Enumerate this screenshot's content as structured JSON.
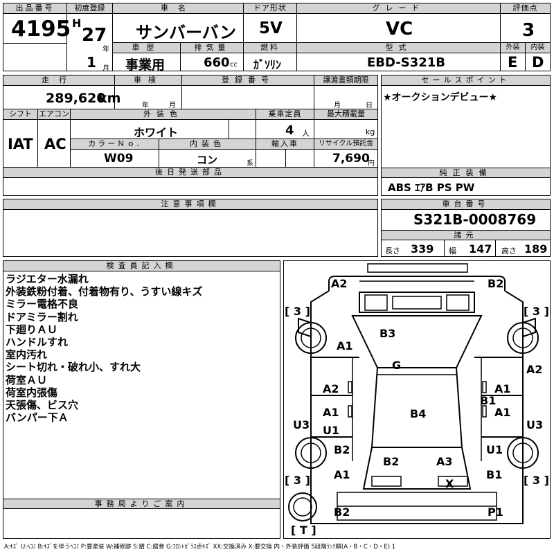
{
  "headers": {
    "lot_no": "出品番号",
    "first_reg": "初度登録",
    "car_name": "車名",
    "door": "ドア形状",
    "grade": "グレード",
    "score": "評価点",
    "history": "車歴",
    "displacement": "排気量",
    "fuel": "燃料",
    "model": "型式",
    "exterior": "外装",
    "interior": "内装",
    "mileage": "走行",
    "inspection": "車検",
    "reg_no": "登録番号",
    "transfer_deadline": "譲渡書類期限",
    "sales_point": "セールスポイント",
    "shift": "シフト",
    "aircon": "エアコン",
    "ext_color": "外装色",
    "capacity": "乗車定員",
    "max_load": "最大積載量",
    "color_no": "カラーＮｏ.",
    "int_color": "内装色",
    "import": "輸入車",
    "recycle": "リサイクル預託金",
    "later_parts": "後日発送部品",
    "options": "純正装備",
    "notes": "注意事項欄",
    "chassis": "車台番号",
    "specs": "諸元",
    "inspector": "検査員記入欄",
    "office": "事務局よりご案内"
  },
  "vehicle": {
    "lot_no": "4195",
    "era": "H",
    "year": "27",
    "year_unit": "年",
    "month": "1",
    "month_unit": "月",
    "name": "サンバーバン",
    "door": "5V",
    "grade": "VC",
    "score": "3",
    "history": "事業用",
    "displacement": "660",
    "displacement_unit": "cc",
    "fuel": "ｶﾞｿﾘﾝ",
    "model": "EBD-S321B",
    "exterior_grade": "E",
    "interior_grade": "D",
    "mileage": "289,620",
    "mileage_unit": "km",
    "insp_year": "年",
    "insp_month": "月",
    "deadline_month": "月",
    "deadline_day": "日",
    "shift": "IAT",
    "aircon": "AC",
    "color": "ホワイト",
    "capacity": "4",
    "capacity_unit": "人",
    "load_unit": "kg",
    "color_no": "W09",
    "int_color": "コン",
    "int_color_unit": "系",
    "recycle": "7,690",
    "recycle_unit": "円",
    "sales_point": "★オークションデビュー★",
    "options": "ABS ｴｱB PS PW",
    "chassis": "S321B-0008769",
    "length_label": "長さ",
    "length": "339",
    "width_label": "幅",
    "width": "147",
    "height_label": "高さ",
    "height": "189"
  },
  "remarks": [
    "ラジエター水漏れ",
    "外装鉄粉付着、付着物有り、うすい線キズ",
    "ミラー電格不良",
    "ドアミラー割れ",
    "下廻りＡＵ",
    "ハンドルすれ",
    "室内汚れ",
    "シート切れ・破れ小、すれ大",
    "荷室ＡＵ",
    "荷室内張傷",
    "天張傷、ビス穴",
    "バンパー下Ａ"
  ],
  "diagram": {
    "marks": {
      "front_left": "A2",
      "front_right": "B2",
      "hood_left": "A1",
      "windshield": "B3",
      "roof_front": "G",
      "right_front_pillar": "A2",
      "left_front_door": "A2",
      "right_front_door": "A1",
      "right_mid": "B1",
      "left_rear_door": "A1",
      "right_rear_door": "A1",
      "roof": "B4",
      "left_sill": "U3",
      "right_sill": "U3",
      "left_lower": "U1",
      "left_rear_quarter": "B2",
      "right_rear_quarter": "U1",
      "rear_glass_left": "B2",
      "rear_glass_right": "A3",
      "left_rear_corner": "A1",
      "right_rear_corner": "B1",
      "rear_bumper_x": "X",
      "rear_left": "B2",
      "rear_right": "P1"
    },
    "tires": {
      "front_left": "[ 3 ]",
      "front_right": "[ 3 ]",
      "rear_left": "[ 3 ]",
      "rear_right": "[ 3 ]",
      "spare": "[ T ]"
    }
  },
  "legend": "A:ｷｽﾞ U:ﾍｺﾐ B:ｷｽﾞを伴うﾍｺﾐ P:要塗装 W:補修跡 S:錆 C:腐食 G:ﾌﾛﾝﾄｶﾞﾗｽ点ｷｽﾞ XX:交換済み X:要交換  内・外装評価 5段階ﾗﾝｸ順(A・B・C・D・E) 1"
}
